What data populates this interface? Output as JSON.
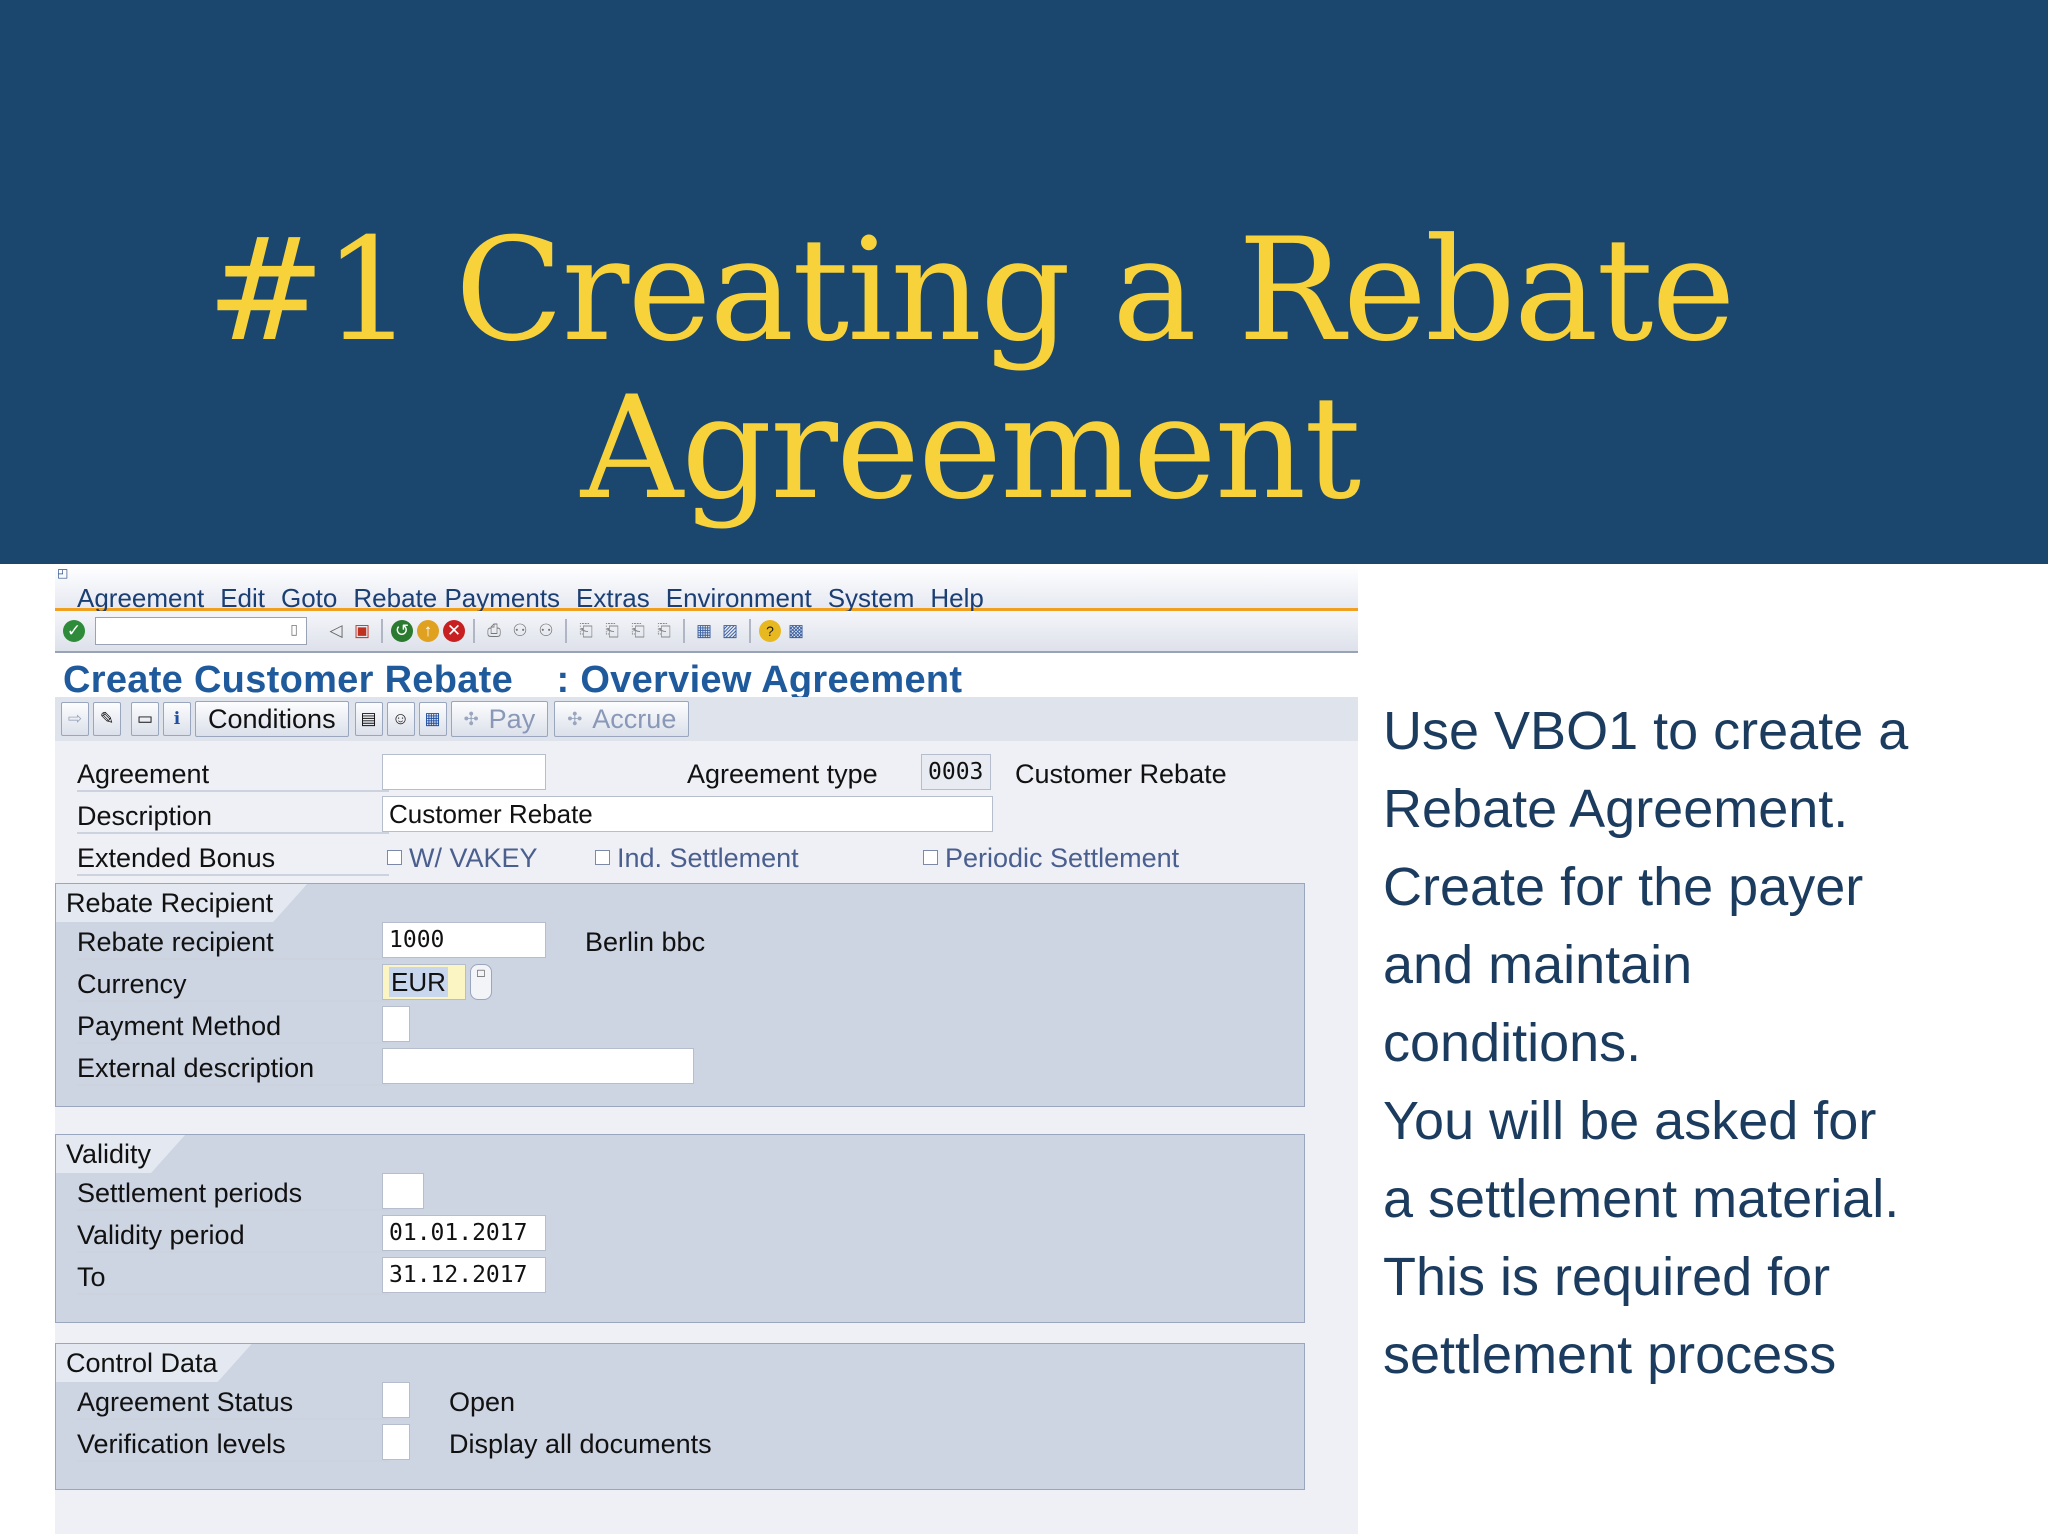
{
  "slide": {
    "title_line1": "#1 Creating a Rebate",
    "title_line2": "Agreement",
    "note_lines": [
      "Use VBO1 to create a",
      "Rebate Agreement.",
      "Create for the payer",
      "and maintain",
      "conditions.",
      "You will be asked for",
      "a settlement material.",
      "This is required for",
      "settlement process"
    ]
  },
  "sap": {
    "menu": [
      "Agreement",
      "Edit",
      "Goto",
      "Rebate Payments",
      "Extras",
      "Environment",
      "System",
      "Help"
    ],
    "screen_title": "Create Customer Rebate    : Overview Agreement",
    "app_toolbar": {
      "conditions": "Conditions",
      "pay": "Pay",
      "accrue": "Accrue"
    },
    "header": {
      "agreement_label": "Agreement",
      "agreement_value": "",
      "agreement_type_label": "Agreement type",
      "agreement_type_value": "0003",
      "agreement_type_text": "Customer Rebate",
      "description_label": "Description",
      "description_value": "Customer Rebate",
      "extended_bonus_label": "Extended Bonus",
      "chk_vakey": "W/ VAKEY",
      "chk_ind_settlement": "Ind. Settlement",
      "chk_periodic_settlement": "Periodic Settlement"
    },
    "rebate_recipient": {
      "group_title": "Rebate Recipient",
      "recipient_label": "Rebate recipient",
      "recipient_value": "1000",
      "recipient_name": "Berlin bbc",
      "currency_label": "Currency",
      "currency_value": "EUR",
      "payment_method_label": "Payment Method",
      "payment_method_value": "",
      "external_description_label": "External description",
      "external_description_value": ""
    },
    "validity": {
      "group_title": "Validity",
      "settlement_periods_label": "Settlement periods",
      "settlement_periods_value": "",
      "validity_period_label": "Validity period",
      "validity_from": "01.01.2017",
      "to_label": "To",
      "validity_to": "31.12.2017"
    },
    "control_data": {
      "group_title": "Control Data",
      "agreement_status_label": "Agreement Status",
      "agreement_status_value": "",
      "agreement_status_text": "Open",
      "verification_levels_label": "Verification levels",
      "verification_levels_value": "",
      "verification_levels_text": "Display all documents"
    }
  }
}
